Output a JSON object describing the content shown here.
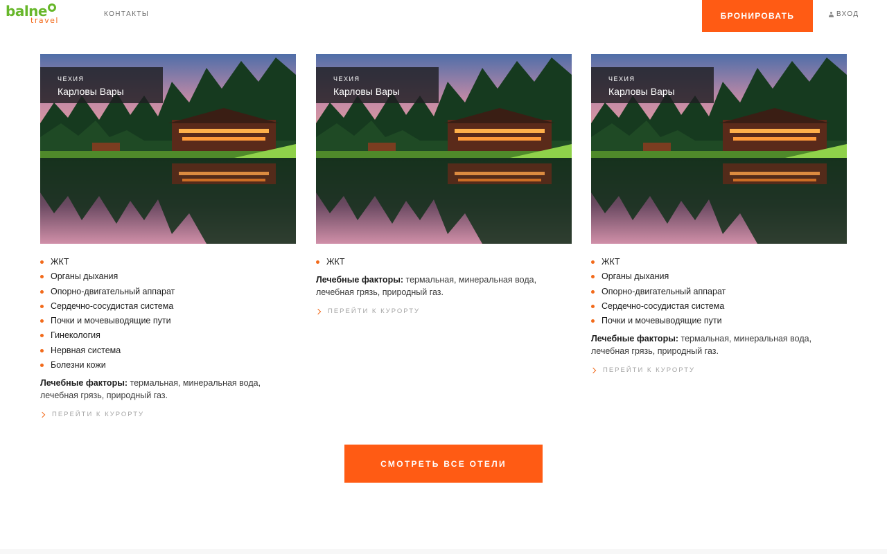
{
  "header": {
    "logo": {
      "main": "balne",
      "sub": "travel"
    },
    "nav_contacts": "КОНТАКТЫ",
    "book_button": "БРОНИРОВАТЬ",
    "login": "ВХОД"
  },
  "colors": {
    "accent": "#ff5b14",
    "logo_green": "#67b72a",
    "bullet": "#f26a1b"
  },
  "cards": [
    {
      "country": "ЧЕХИЯ",
      "city": "Карловы Вары",
      "features": [
        "ЖКТ",
        "Органы дыхания",
        "Опорно-двигательный аппарат",
        "Сердечно-сосудистая система",
        "Почки и мочевыводящие пути",
        "Гинекология",
        "Нервная система",
        "Болезни кожи"
      ],
      "factors_label": "Лечебные факторы:",
      "factors_text": " термальная, минеральная вода, лечебная грязь, природный газ.",
      "link": "ПЕРЕЙТИ К КУРОРТУ"
    },
    {
      "country": "ЧЕХИЯ",
      "city": "Карловы Вары",
      "features": [
        "ЖКТ"
      ],
      "factors_label": "Лечебные факторы:",
      "factors_text": " термальная, минеральная вода, лечебная грязь, природный газ.",
      "link": "ПЕРЕЙТИ К КУРОРТУ"
    },
    {
      "country": "ЧЕХИЯ",
      "city": "Карловы Вары",
      "features": [
        "ЖКТ",
        "Органы дыхания",
        "Опорно-двигательный аппарат",
        "Сердечно-сосудистая система",
        "Почки и мочевыводящие пути"
      ],
      "factors_label": "Лечебные факторы:",
      "factors_text": " термальная, минеральная вода, лечебная грязь, природный газ.",
      "link": "ПЕРЕЙТИ К КУРОРТУ"
    }
  ],
  "all_hotels_button": "СМОТРЕТЬ ВСЕ ОТЕЛИ"
}
